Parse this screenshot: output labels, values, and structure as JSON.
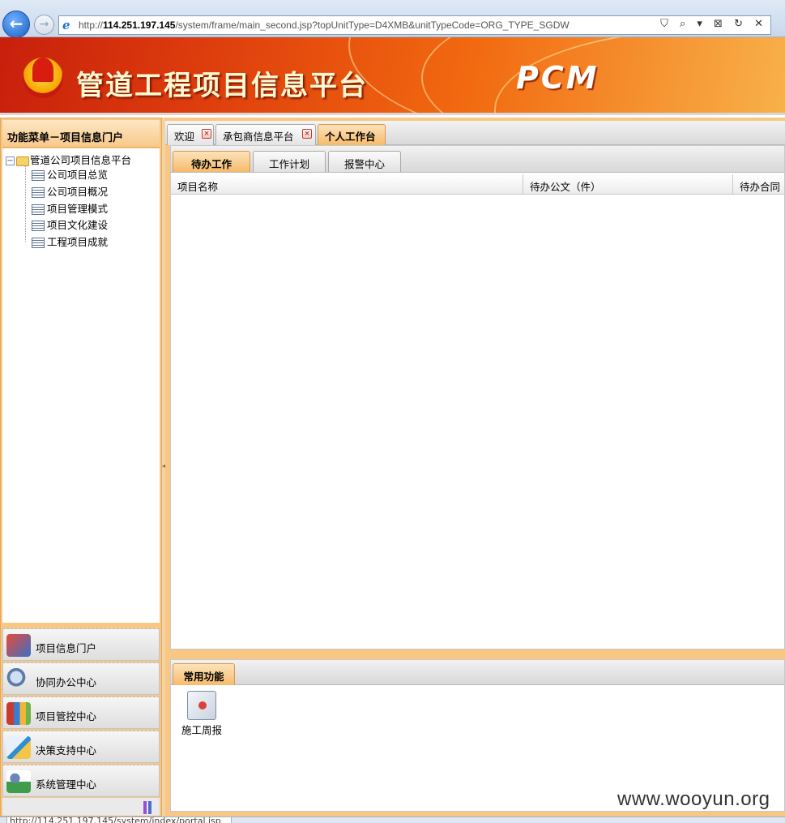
{
  "browser": {
    "url_prefix": "http://",
    "url_host": "114.251.197.145",
    "url_path": "/system/frame/main_second.jsp?topUnitType=D4XMB&unitTypeCode=ORG_TYPE_SGDW",
    "back_glyph": "←",
    "forward_glyph": "→",
    "ie_glyph": "e",
    "tools": "⛉ ⌕ ▾ ⊠ ↻ ✕",
    "status_url": "http://114.251.197.145/system/index/portal.jsp"
  },
  "header": {
    "title": "管道工程项目信息平台",
    "product": "PCM"
  },
  "left": {
    "title": "功能菜单－项目信息门户",
    "tree": {
      "expander": "−",
      "root": "管道公司项目信息平台",
      "items": [
        "公司项目总览",
        "公司项目概况",
        "项目管理模式",
        "项目文化建设",
        "工程项目成就"
      ]
    },
    "modules": [
      {
        "label": "项目信息门户",
        "icon": "portal-icon",
        "color": "#3a6fc4"
      },
      {
        "label": "协同办公中心",
        "icon": "search-icon",
        "color": "#5b7ba8"
      },
      {
        "label": "项目管控中心",
        "icon": "books-icon",
        "color": "#c83b2f"
      },
      {
        "label": "决策支持中心",
        "icon": "pen-icon",
        "color": "#2f8fd0"
      },
      {
        "label": "系统管理中心",
        "icon": "users-icon",
        "color": "#3f9c4a"
      }
    ]
  },
  "tabs": {
    "main": [
      "欢迎",
      "承包商信息平台",
      "个人工作台"
    ],
    "close_glyph": "×",
    "sub": [
      "待办工作",
      "工作计划",
      "报警中心"
    ],
    "grid_columns": [
      "项目名称",
      "待办公文（件）",
      "待办合同"
    ]
  },
  "common": {
    "tab": "常用功能",
    "shortcuts": [
      {
        "label": "施工周报",
        "icon": "weekly-report-icon"
      }
    ]
  },
  "watermark": "www.wooyun.org",
  "colors": {
    "header_start": "#c81f0c",
    "header_end": "#f8b14a",
    "panel_orange": "#f7c783",
    "active_tab": "#f6bb6b"
  }
}
